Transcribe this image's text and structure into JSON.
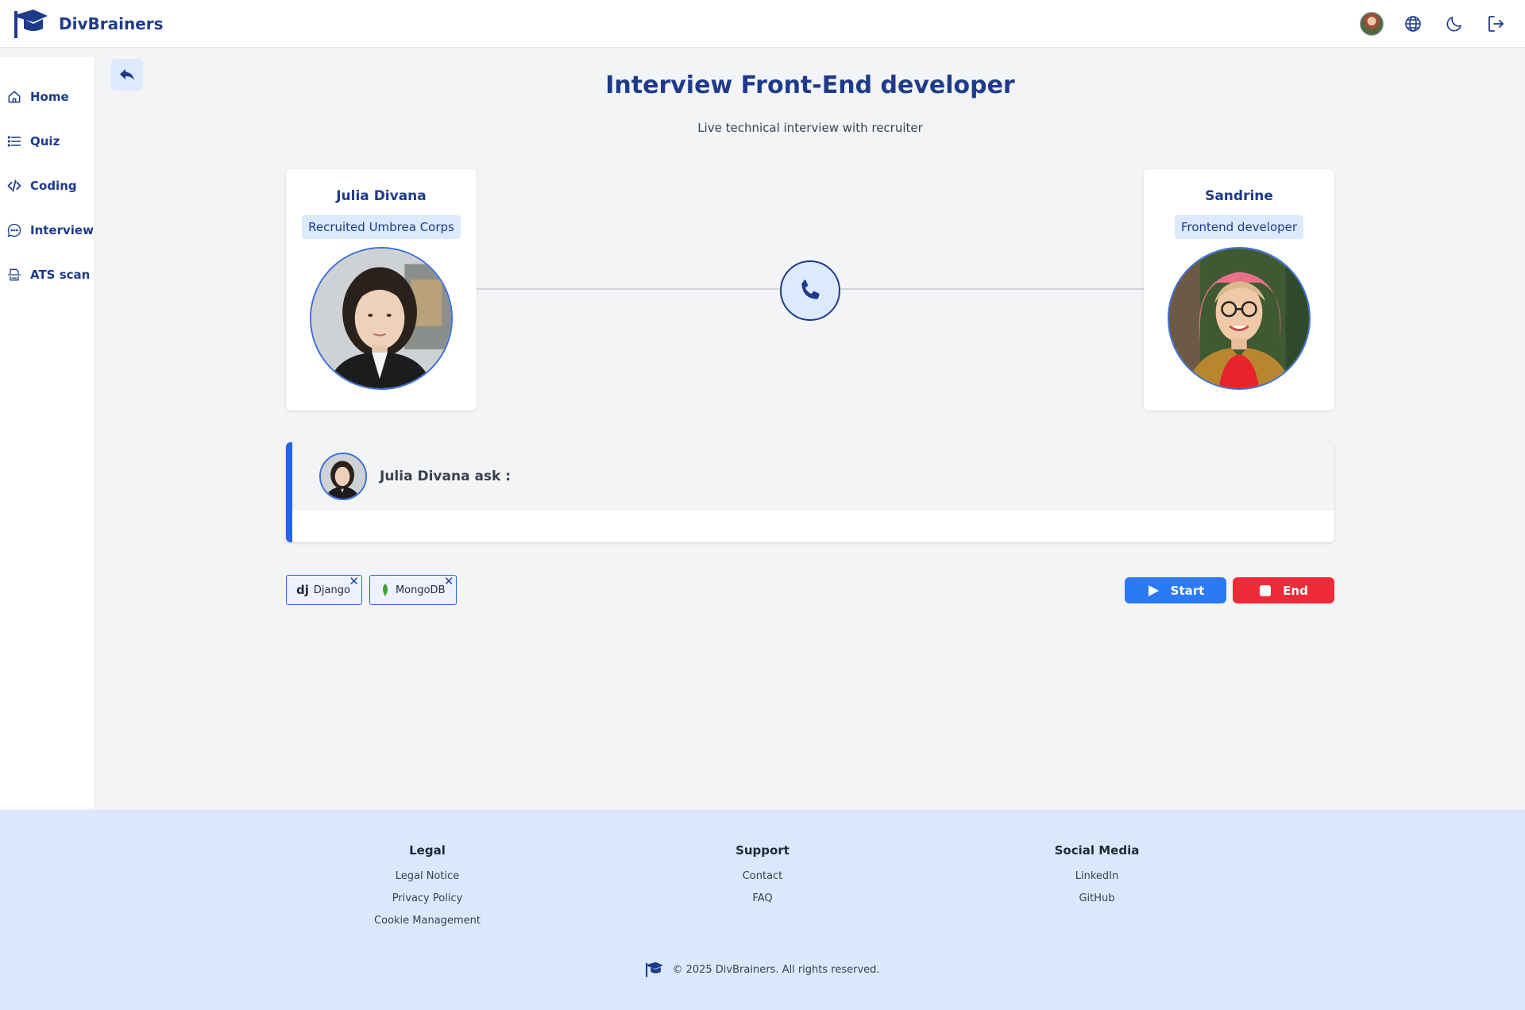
{
  "header": {
    "brand": "DivBrainers",
    "icons": [
      "user-avatar",
      "globe-icon",
      "moon-icon",
      "logout-icon"
    ]
  },
  "sidebar": {
    "items": [
      {
        "label": "Home",
        "icon": "home-icon"
      },
      {
        "label": "Quiz",
        "icon": "list-icon"
      },
      {
        "label": "Coding",
        "icon": "code-icon"
      },
      {
        "label": "Interview",
        "icon": "chat-icon"
      },
      {
        "label": "ATS scan",
        "icon": "scan-icon"
      }
    ]
  },
  "main": {
    "title": "Interview Front-End developer",
    "subtitle": "Live technical interview with recruiter",
    "recruiter": {
      "name": "Julia Divana",
      "role": "Recruited Umbrea Corps"
    },
    "candidate": {
      "name": "Sandrine",
      "role": "Frontend developer"
    },
    "question": {
      "label": "Julia Divana ask :",
      "text": ""
    },
    "tags": [
      {
        "logo": "dj",
        "label": "Django",
        "icon": "django-icon"
      },
      {
        "logo": "",
        "label": "MongoDB",
        "icon": "mongodb-leaf-icon"
      }
    ],
    "start_label": "Start",
    "end_label": "End"
  },
  "footer": {
    "columns": [
      {
        "heading": "Legal",
        "links": [
          "Legal Notice",
          "Privacy Policy",
          "Cookie Management"
        ]
      },
      {
        "heading": "Support",
        "links": [
          "Contact",
          "FAQ"
        ]
      },
      {
        "heading": "Social Media",
        "links": [
          "LinkedIn",
          "GitHub"
        ]
      }
    ],
    "copyright": "© 2025 DivBrainers. All rights reserved."
  },
  "colors": {
    "brand": "#1e3a8a",
    "accent": "#2563eb",
    "start": "#2b7af3",
    "end": "#ef2b39",
    "footer_bg": "#dbe8fc"
  }
}
